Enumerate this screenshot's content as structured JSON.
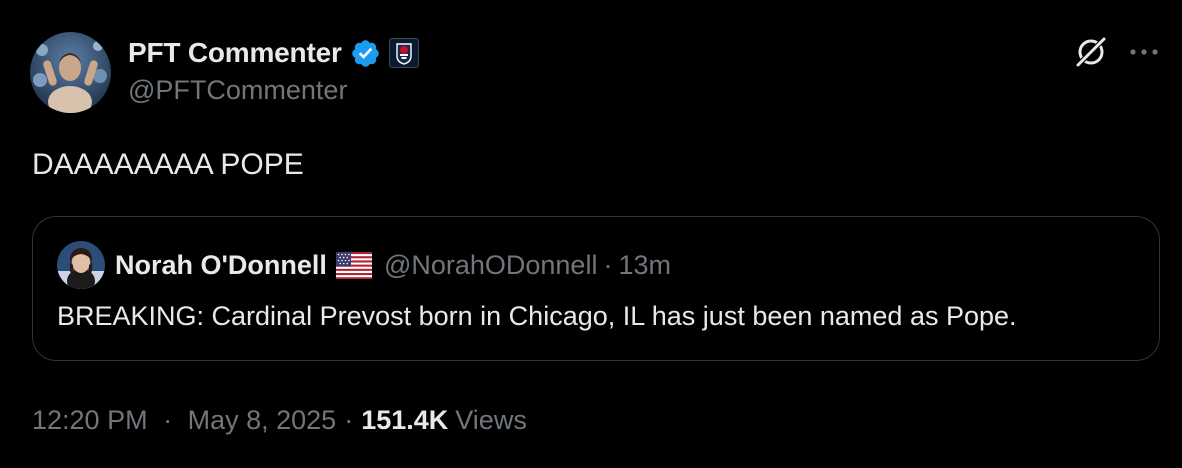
{
  "tweet": {
    "author": {
      "display_name": "PFT Commenter",
      "handle": "@PFTCommenter",
      "verified_icon": "verified-badge-icon",
      "affiliate_icon": "barstool-affiliate-icon",
      "avatar": "avatar"
    },
    "text": "DAAAAAAAA POPE",
    "actions": {
      "grok_icon": "grok-icon",
      "more_icon": "more-dots-icon"
    },
    "quote": {
      "display_name": "Norah O'Donnell",
      "flag": "us-flag-icon",
      "handle": "@NorahODonnell",
      "separator": "·",
      "time": "13m",
      "text": "BREAKING: Cardinal Prevost born in Chicago, IL has just been named as Pope."
    },
    "meta": {
      "time": "12:20 PM",
      "separator": "·",
      "date": "May 8, 2025",
      "views_count": "151.4K",
      "views_label": "Views"
    }
  },
  "colors": {
    "background": "#000000",
    "primary_text": "#e7e9ea",
    "secondary_text": "#71767b",
    "border": "#2f3336",
    "verified_blue": "#1d9bf0"
  }
}
